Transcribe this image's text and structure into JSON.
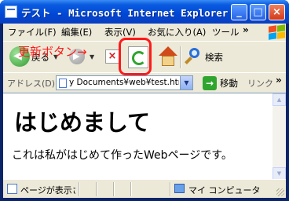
{
  "window": {
    "title": "テスト - Microsoft Internet Explorer"
  },
  "title_buttons": {
    "minimize": "_",
    "maximize": "□",
    "close": "×"
  },
  "menu": {
    "items": [
      "ファイル(F)",
      "編集(E)",
      "表示(V)",
      "お気に入り(A)",
      "ツール"
    ],
    "more": "»"
  },
  "toolbar": {
    "back_label": "戻る",
    "search_label": "検索",
    "annotation": "更新ボタン→"
  },
  "address": {
    "label": "アドレス(D)",
    "value": "y Documents¥web¥test.html",
    "go_label": "移動",
    "links_label": "リンク",
    "links_more": "»"
  },
  "page": {
    "heading": "はじめまして",
    "paragraph": "これは私がはじめて作ったWebページです。"
  },
  "status": {
    "text": "ページが表示さ",
    "zone": "マイ コンピュータ"
  },
  "colors": {
    "titlebar": "#0a5be0",
    "chrome": "#ece9d8",
    "highlight": "#ff1a1a",
    "refresh_icon": "#2fa52f"
  },
  "icons": [
    "ie-page-icon",
    "back-arrow-icon",
    "forward-arrow-icon",
    "stop-icon",
    "refresh-icon",
    "home-icon",
    "search-icon",
    "go-arrow-icon",
    "windows-logo-icon",
    "computer-icon"
  ]
}
